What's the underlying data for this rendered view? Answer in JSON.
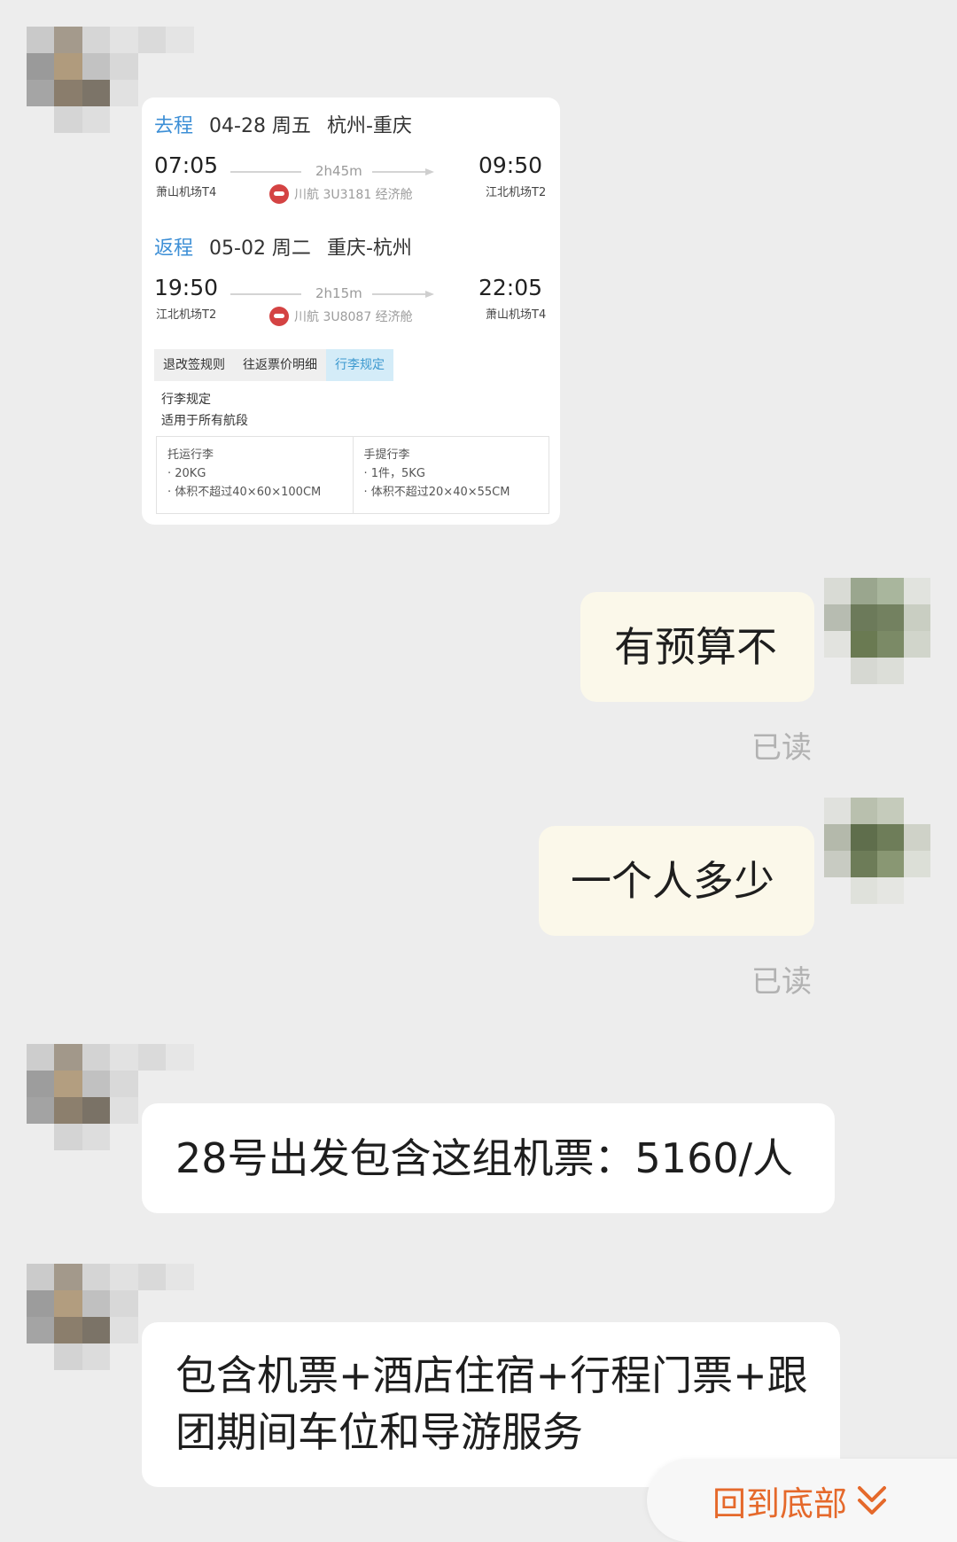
{
  "flight_card": {
    "outbound": {
      "tag": "去程",
      "date": "04-28 周五",
      "route": "杭州-重庆",
      "dep_time": "07:05",
      "dep_airport": "萧山机场T4",
      "duration": "2h45m",
      "flight": "川航 3U3181 经济舱",
      "arr_time": "09:50",
      "arr_airport": "江北机场T2"
    },
    "return": {
      "tag": "返程",
      "date": "05-02 周二",
      "route": "重庆-杭州",
      "dep_time": "19:50",
      "dep_airport": "江北机场T2",
      "duration": "2h15m",
      "flight": "川航 3U8087 经济舱",
      "arr_time": "22:05",
      "arr_airport": "萧山机场T4"
    },
    "tabs": [
      "退改签规则",
      "往返票价明细",
      "行李规定"
    ],
    "active_tab": "行李规定",
    "section_title": "行李规定",
    "section_note": "适用于所有航段",
    "checked": {
      "title": "托运行李",
      "line1": "· 20KG",
      "line2": "· 体积不超过40×60×100CM"
    },
    "carry_on": {
      "title": "手提行李",
      "line1": "· 1件，5KG",
      "line2": "· 体积不超过20×40×55CM"
    }
  },
  "messages": {
    "me1": "有预算不",
    "me1_status": "已读",
    "me2": "一个人多少",
    "me2_status": "已读",
    "other1": "28号出发包含这组机票：5160/人",
    "other2": "包含机票+酒店住宿+行程门票+跟团期间车位和导游服务"
  },
  "jump_to_bottom": "回到底部",
  "icons": {
    "jump": "double-chevron-down-icon",
    "airline": "sichuan-airlines-logo-icon"
  },
  "colors": {
    "accent": "#e5692b",
    "link_blue": "#3d8fd6",
    "my_bubble": "#fbf8ea"
  }
}
